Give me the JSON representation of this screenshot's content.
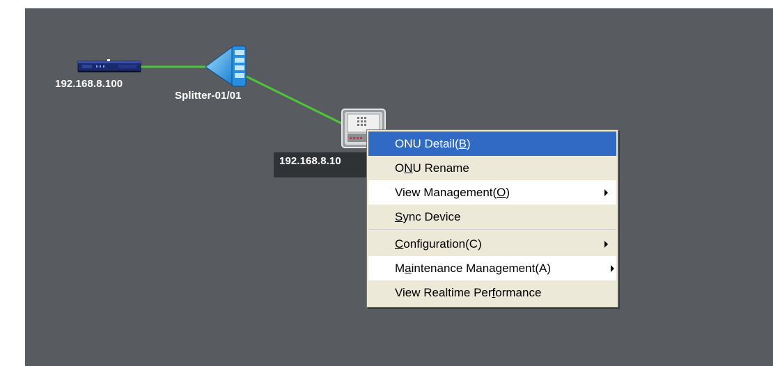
{
  "topology": {
    "olt": {
      "label": "192.168.8.100",
      "icon": "olt-rack-icon"
    },
    "splitter": {
      "label": "Splitter-01/01",
      "icon": "optical-splitter-icon"
    },
    "onu": {
      "label": "192.168.8.10",
      "icon": "onu-device-icon"
    },
    "link_color": "#4cc638",
    "canvas_color": "#585b5f"
  },
  "context_menu": {
    "items": [
      {
        "pre": "ONU Detail(",
        "key": "B",
        "post": ")",
        "state": "highlighted"
      },
      {
        "pre": "O",
        "key": "N",
        "post": "U Rename"
      },
      {
        "pre": "View Management(",
        "key": "O",
        "post": ")",
        "submenu": true
      },
      {
        "pre": "",
        "key": "S",
        "post": "ync Device"
      },
      {
        "pre": "",
        "key": "C",
        "post": "onfiguration(C)",
        "submenu": true
      },
      {
        "pre": "M",
        "key": "a",
        "post": "intenance Management(A)",
        "submenu": true
      },
      {
        "pre": "View Realtime Per",
        "key": "f",
        "post": "ormance"
      }
    ],
    "highlight_color": "#316ac5",
    "background_color": "#ece9d8"
  }
}
